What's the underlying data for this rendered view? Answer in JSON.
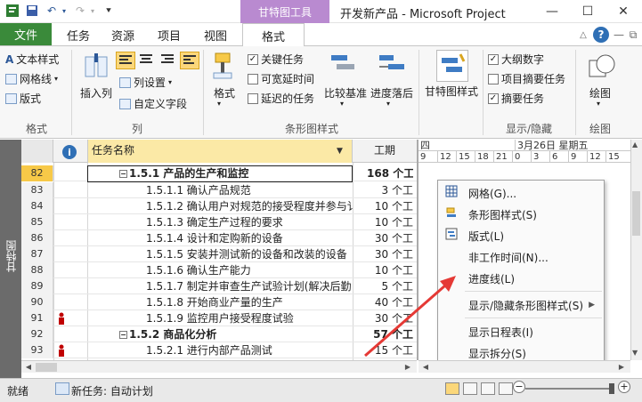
{
  "window": {
    "context_tab": "甘特图工具",
    "title": "开发新产品 - Microsoft Project",
    "controls": [
      "—",
      "☐",
      "✕"
    ]
  },
  "ribbon_tabs": {
    "file": "文件",
    "items": [
      "任务",
      "资源",
      "项目",
      "视图"
    ],
    "format": "格式"
  },
  "ribbon": {
    "format_group": {
      "label": "格式",
      "text_styles": "文本样式",
      "gridlines": "网格线",
      "layout": "版式"
    },
    "columns_group": {
      "label": "列",
      "insert_column": "插入列",
      "column_settings": "列设置",
      "custom_fields": "自定义字段"
    },
    "bar_styles_group": {
      "label": "条形图样式",
      "format_btn": "格式",
      "critical_tasks": "关键任务",
      "slack": "可宽延时间",
      "late_tasks": "延迟的任务",
      "compare_baseline": "比较基准",
      "slippage": "进度落后"
    },
    "gantt_style_group": {
      "gantt_chart_style": "甘特图样式"
    },
    "show_hide_group": {
      "label": "显示/隐藏",
      "outline_number": "大纲数字",
      "project_summary": "项目摘要任务",
      "summary_tasks": "摘要任务",
      "outline_checked": true,
      "project_summary_checked": false,
      "summary_checked": true
    },
    "drawings_group": {
      "label": "绘图",
      "drawing": "绘图"
    }
  },
  "grid": {
    "view_label": "甘特图",
    "header_name": "任务名称",
    "header_duration": "工期",
    "rows": [
      {
        "id": "82",
        "name": "1.5.1  产品的生产和监控",
        "duration": "168 个工",
        "summary": true,
        "indicator": false,
        "selected": true
      },
      {
        "id": "83",
        "name": "1.5.1.1  确认产品规范",
        "duration": "3 个工",
        "summary": false,
        "indicator": false,
        "selected": false
      },
      {
        "id": "84",
        "name": "1.5.1.2  确认用户对规范的接受程度并参与讠",
        "duration": "10 个工",
        "summary": false,
        "indicator": false,
        "selected": false
      },
      {
        "id": "85",
        "name": "1.5.1.3  确定生产过程的要求",
        "duration": "10 个工",
        "summary": false,
        "indicator": false,
        "selected": false
      },
      {
        "id": "86",
        "name": "1.5.1.4  设计和定购新的设备",
        "duration": "30 个工",
        "summary": false,
        "indicator": false,
        "selected": false
      },
      {
        "id": "87",
        "name": "1.5.1.5  安装并测试新的设备和改装的设备",
        "duration": "30 个工",
        "summary": false,
        "indicator": false,
        "selected": false
      },
      {
        "id": "88",
        "name": "1.5.1.6  确认生产能力",
        "duration": "10 个工",
        "summary": false,
        "indicator": false,
        "selected": false
      },
      {
        "id": "89",
        "name": "1.5.1.7  制定并审查生产试验计划(解决后勤",
        "duration": "5 个工",
        "summary": false,
        "indicator": false,
        "selected": false
      },
      {
        "id": "90",
        "name": "1.5.1.8  开始商业产量的生产",
        "duration": "40 个工",
        "summary": false,
        "indicator": false,
        "selected": false
      },
      {
        "id": "91",
        "name": "1.5.1.9  监控用户接受程度试验",
        "duration": "30 个工",
        "summary": false,
        "indicator": true,
        "selected": false
      },
      {
        "id": "92",
        "name": "1.5.2  商品化分析",
        "duration": "57 个工",
        "summary": true,
        "indicator": false,
        "selected": false
      },
      {
        "id": "93",
        "name": "1.5.2.1  进行内部产品测试",
        "duration": "15 个工",
        "summary": false,
        "indicator": true,
        "selected": false
      }
    ]
  },
  "timescale": {
    "top": [
      "四",
      "3月26日  星期五"
    ],
    "bottom": [
      "9",
      "12",
      "15",
      "18",
      "21",
      "0",
      "3",
      "6",
      "9",
      "12",
      "15"
    ]
  },
  "context_menu": {
    "items": [
      {
        "label": "网格(G)...",
        "icon": "grid-icon"
      },
      {
        "label": "条形图样式(S)",
        "icon": "bar-style-icon"
      },
      {
        "label": "版式(L)",
        "icon": "layout-icon"
      },
      {
        "label": "非工作时间(N)...",
        "icon": "nonworking-time-icon"
      },
      {
        "label": "进度线(L)",
        "icon": "progress-line-icon"
      },
      {
        "label": "显示/隐藏条形图样式(S)",
        "icon": "none",
        "submenu": true
      },
      {
        "label": "显示日程表(I)",
        "icon": "none"
      },
      {
        "label": "显示拆分(S)",
        "icon": "none"
      }
    ]
  },
  "statusbar": {
    "ready": "就绪",
    "new_task": "新任务: 自动计划"
  },
  "colors": {
    "file_tab": "#3a8a3a",
    "context_tab": "#b98ad0",
    "selected_row": "#f7c948",
    "header_name": "#fbe9a6",
    "arrow": "#e53935"
  }
}
